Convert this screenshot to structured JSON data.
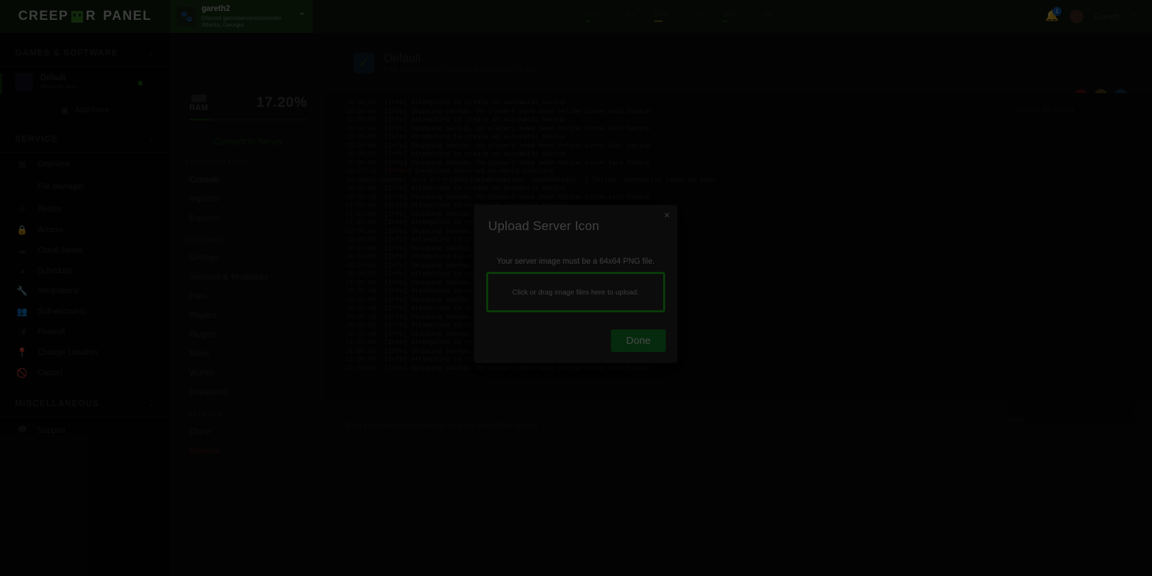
{
  "brand": {
    "word1": "CREEP",
    "word2": "R",
    "word3": "PANEL",
    "icon": "creeper-face-icon"
  },
  "topbar": {
    "server": {
      "name": "gareth2",
      "sub_line1": "Discord gameservers/consoles",
      "sub_line2": "Atlanta, Georgia",
      "icon": "server-thumb-icon",
      "chevron": "⌃"
    },
    "stats": [
      {
        "label": "CPU",
        "value": "4%",
        "pct": 4,
        "color": "#1c5c12"
      },
      {
        "label": "RAM",
        "value": "17%",
        "pct": 17,
        "color": "#8a7a12"
      },
      {
        "label": "DISK",
        "value": "5%",
        "pct": 5,
        "color": "#1c5c12"
      }
    ],
    "notifications": {
      "icon": "bell-icon",
      "count": "1"
    },
    "user": {
      "name": "Gareth",
      "avatar": "user-avatar",
      "chevron": "⌃"
    }
  },
  "sidebar": {
    "sections": [
      {
        "title": "GAMES & SOFTWARE",
        "chevron": "⌄"
      },
      {
        "title": "SERVICE",
        "chevron": "⌄"
      },
      {
        "title": "MISCELLANEOUS",
        "chevron": "⌄"
      }
    ],
    "server_entry": {
      "name": "Default",
      "sub": "Minecraft Java",
      "status": "online"
    },
    "add_more": {
      "label": "Add more",
      "icon": "plus-box-icon"
    },
    "service_items": [
      {
        "label": "Overview",
        "icon": "grid-icon"
      },
      {
        "label": "File Manager",
        "icon": "folder-icon"
      },
      {
        "label": "Resize",
        "icon": "resize-icon"
      },
      {
        "label": "Access",
        "icon": "lock-icon"
      },
      {
        "label": "Cloud Saves",
        "icon": "cloud-icon"
      },
      {
        "label": "Scheduler",
        "icon": "clock-icon"
      },
      {
        "label": "Integrations",
        "icon": "wrench-icon"
      },
      {
        "label": "Sub-accounts",
        "icon": "users-icon"
      },
      {
        "label": "Firewall",
        "icon": "shield-icon"
      },
      {
        "label": "Change Location",
        "icon": "map-pin-icon"
      },
      {
        "label": "Cancel",
        "icon": "ban-icon"
      }
    ],
    "misc_items": [
      {
        "label": "Support",
        "icon": "chat-icon"
      }
    ]
  },
  "panel2": {
    "ram": {
      "label": "RAM",
      "value": "17.20%",
      "pct": 17.2,
      "icon": "ram-chip-icon"
    },
    "connect_label": "Connect to Server",
    "groups": [
      {
        "title": "ADMINISTRATION",
        "items": [
          {
            "label": "Console",
            "state": "active"
          },
          {
            "label": "Importer",
            "state": "normal"
          },
          {
            "label": "Exporter",
            "state": "normal"
          }
        ]
      },
      {
        "title": "SETTINGS",
        "items": [
          {
            "label": "Settings",
            "state": "normal"
          },
          {
            "label": "Versions & Modpacks",
            "state": "normal"
          },
          {
            "label": "Files",
            "state": "normal"
          },
          {
            "label": "Players",
            "state": "normal"
          },
          {
            "label": "Plugins",
            "state": "normal"
          },
          {
            "label": "Mods",
            "state": "normal"
          },
          {
            "label": "Worlds",
            "state": "normal"
          },
          {
            "label": "Datapacks",
            "state": "normal"
          }
        ]
      },
      {
        "title": "INSTANCE",
        "items": [
          {
            "label": "Clone",
            "state": "normal"
          },
          {
            "label": "Remove",
            "state": "danger"
          }
        ]
      }
    ]
  },
  "main": {
    "page": {
      "title": "Default",
      "subtitle": "FTB LEGEND OF THE EYES RELEASE (1.2.0)",
      "icon": "check-icon"
    },
    "actions": [
      {
        "name": "power-button",
        "color": "#5a1212"
      },
      {
        "name": "restart-button",
        "color": "#5a4a12"
      },
      {
        "name": "stop-button",
        "color": "#12395a"
      }
    ],
    "players_panel": {
      "title": "ONLINE PLAYERS"
    },
    "command_placeholder": "Enter your command or message here and press Enter to send",
    "send_label": "SEND",
    "console_lines": [
      {
        "ts": "14:30:00",
        "level": "Info",
        "msg": "Attempting to create an automatic backup"
      },
      {
        "ts": "14:30:00",
        "level": "Info",
        "msg": "Skipping backup, no players have been online since last backup"
      },
      {
        "ts": "15:00:00",
        "level": "Info",
        "msg": "Attempting to create an automatic backup"
      },
      {
        "ts": "15:00:00",
        "level": "Info",
        "msg": "Skipping backup, no players have been online since last backup"
      },
      {
        "ts": "15:30:00",
        "level": "Info",
        "msg": "Attempting to create an automatic backup"
      },
      {
        "ts": "15:30:00",
        "level": "Info",
        "msg": "Skipping backup, no players have been online since last backup"
      },
      {
        "ts": "16:00:00",
        "level": "Info",
        "msg": "Attempting to create an automatic backup"
      },
      {
        "ts": "16:00:00",
        "level": "Info",
        "msg": "Skipping backup, no players have been online since last backup"
      },
      {
        "ts": "16:25:11",
        "level": "Error",
        "msg": "Exception occurred in netty pipeline"
      },
      {
        "ts": "",
        "level": "",
        "msg": "io.netty.channel.unix.Errors$NativeIoException: readAddress(..) failed: Connection reset by peer"
      },
      {
        "ts": "16:30:00",
        "level": "Info",
        "msg": "Attempting to create an automatic backup"
      },
      {
        "ts": "16:30:00",
        "level": "Info",
        "msg": "Skipping backup, no players have been online since last backup"
      },
      {
        "ts": "17:00:00",
        "level": "Info",
        "msg": "Attempting to create an automatic backup"
      },
      {
        "ts": "17:00:00",
        "level": "Info",
        "msg": "Skipping backup, no players have been online since last backup"
      },
      {
        "ts": "17:30:00",
        "level": "Info",
        "msg": "Attempting to create an automatic backup"
      },
      {
        "ts": "17:30:00",
        "level": "Info",
        "msg": "Skipping backup, no players have been online since last backup"
      },
      {
        "ts": "18:00:00",
        "level": "Info",
        "msg": "Attempting to create an automatic backup"
      },
      {
        "ts": "18:00:00",
        "level": "Info",
        "msg": "Skipping backup, no players have been online since last backup"
      },
      {
        "ts": "18:30:00",
        "level": "Info",
        "msg": "Attempting to create an automatic backup"
      },
      {
        "ts": "18:30:00",
        "level": "Info",
        "msg": "Skipping backup, no players have been online since last backup"
      },
      {
        "ts": "19:00:00",
        "level": "Info",
        "msg": "Attempting to create an automatic backup"
      },
      {
        "ts": "19:00:00",
        "level": "Info",
        "msg": "Skipping backup, no players have been online since last backup"
      },
      {
        "ts": "19:30:00",
        "level": "Info",
        "msg": "Attempting to create an automatic backup"
      },
      {
        "ts": "19:30:00",
        "level": "Info",
        "msg": "Skipping backup, no players have been online since last backup"
      },
      {
        "ts": "20:00:00",
        "level": "Info",
        "msg": "Attempting to create an automatic backup"
      },
      {
        "ts": "20:00:00",
        "level": "Info",
        "msg": "Skipping backup, no players have been online since last backup"
      },
      {
        "ts": "20:30:00",
        "level": "Info",
        "msg": "Attempting to create an automatic backup"
      },
      {
        "ts": "20:30:00",
        "level": "Info",
        "msg": "Skipping backup, no players have been online since last backup"
      },
      {
        "ts": "21:00:00",
        "level": "Info",
        "msg": "Attempting to create an automatic backup"
      },
      {
        "ts": "21:00:00",
        "level": "Info",
        "msg": "Skipping backup, no players have been online since last backup"
      },
      {
        "ts": "21:30:00",
        "level": "Info",
        "msg": "Attempting to create an automatic backup"
      },
      {
        "ts": "21:30:00",
        "level": "Info",
        "msg": "Skipping backup, no players have been online since last backup"
      }
    ]
  },
  "modal": {
    "title": "Upload Server Icon",
    "close_label": "×",
    "note": "Your server image must be a 64x64 PNG file.",
    "dropzone_label": "Click or drag image files here to upload.",
    "done_label": "Done",
    "accent_color": "#23d323",
    "button_color": "#12962f"
  }
}
